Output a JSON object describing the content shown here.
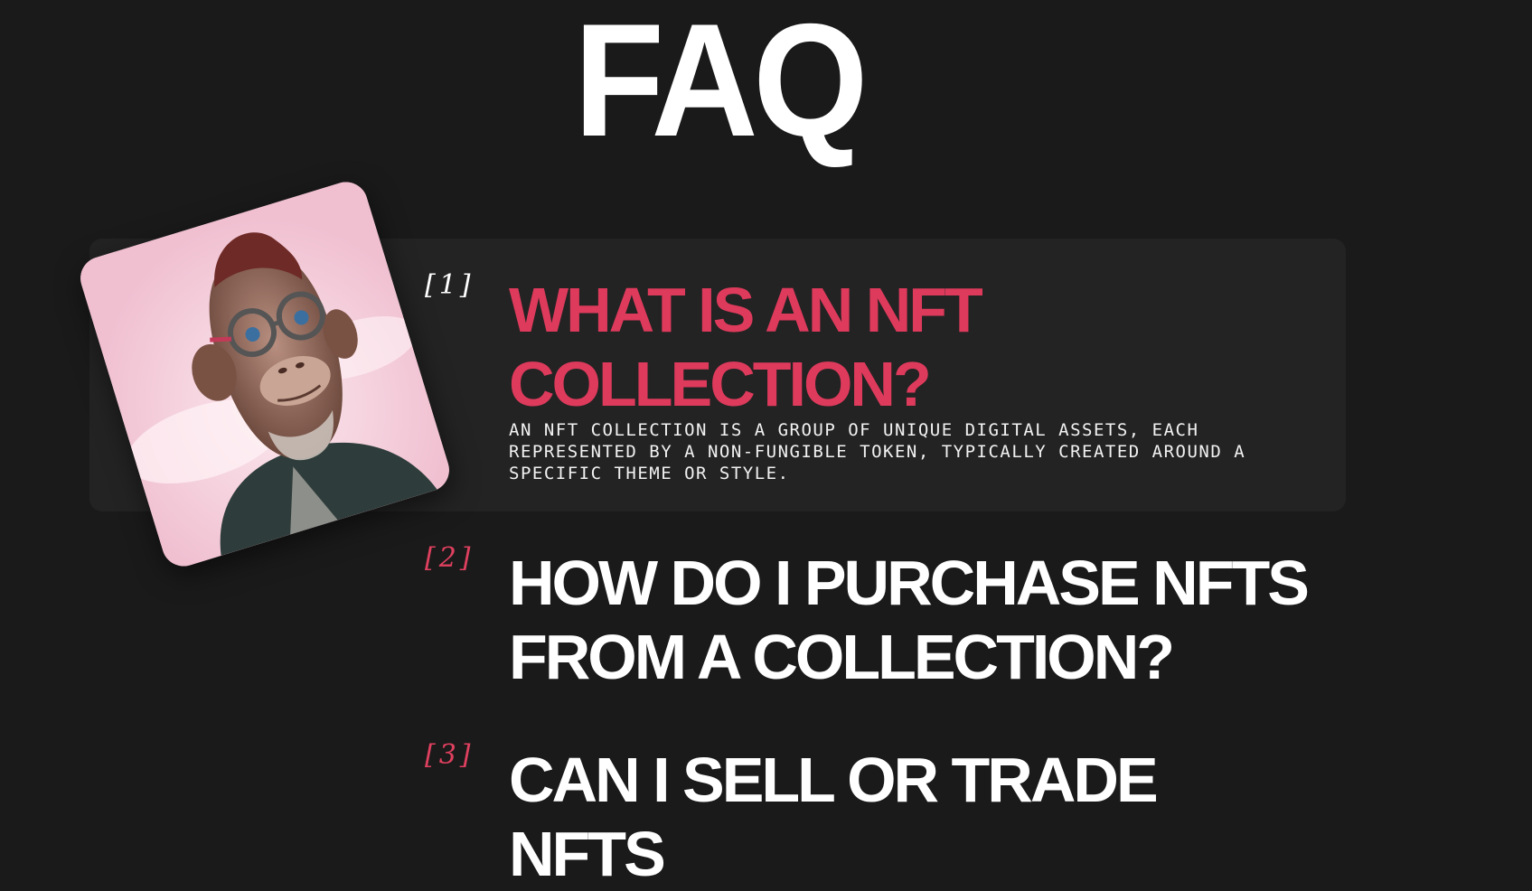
{
  "header": {
    "title": "FAQ"
  },
  "faq": {
    "items": [
      {
        "index": "[1]",
        "question": "What is an NFT collection?",
        "answer": "An NFT collection is a group of unique digital assets, each represented by a non-fungible token, typically created around a specific theme or style.",
        "expanded": true
      },
      {
        "index": "[2]",
        "question": "How do I purchase NFTs from a collection?",
        "expanded": false
      },
      {
        "index": "[3]",
        "question": "Can I sell or trade NFTs",
        "expanded": false
      }
    ]
  },
  "colors": {
    "background": "#1a1a1a",
    "card": "#232323",
    "accent": "#de3a5c",
    "text": "#ffffff"
  }
}
